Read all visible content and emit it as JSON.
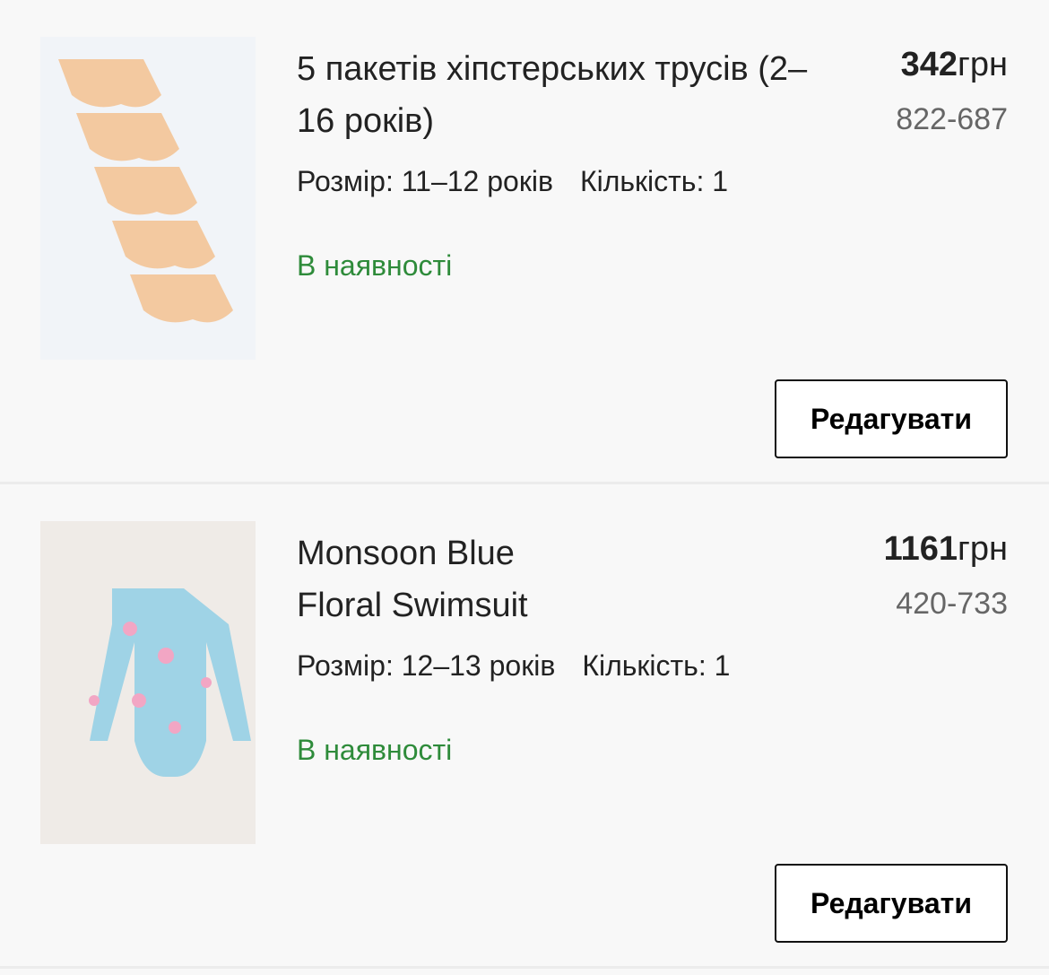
{
  "items": [
    {
      "title": "5 пакетів хіпстерських трусів (2–16 років)",
      "price_value": "342",
      "currency": "грн",
      "code": "822-687",
      "size": "Розмір: 11–12 років",
      "quantity": "Кількість: 1",
      "stock": "В наявності",
      "edit_label": "Редагувати"
    },
    {
      "title": "Monsoon Blue Floral Swimsuit",
      "price_value": "1161",
      "currency": "грн",
      "code": "420-733",
      "size": "Розмір: 12–13 років",
      "quantity": "Кількість: 1",
      "stock": "В наявності",
      "edit_label": "Редагувати"
    }
  ],
  "colors": {
    "stock": "#2e8b3a"
  }
}
